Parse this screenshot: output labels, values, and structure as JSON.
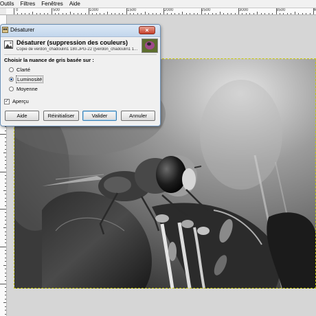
{
  "menu": {
    "items": [
      "Outils",
      "Filtres",
      "Fenêtres",
      "Aide"
    ]
  },
  "ruler": {
    "labels": [
      "0",
      "500",
      "1000",
      "1500",
      "2000",
      "2500",
      "3000",
      "3500",
      "4000"
    ]
  },
  "dialog": {
    "window_title": "Désaturer",
    "header_title": "Désaturer (suppression des couleurs)",
    "header_subtitle": "Copie de verdon_chadoulin1 180.JPG-22 ([verdon_chadoulin1 1...",
    "group_label": "Choisir la nuance de gris basée sur :",
    "options": [
      {
        "label": "Clarté",
        "selected": false
      },
      {
        "label": "Luminosité",
        "selected": true
      },
      {
        "label": "Moyenne",
        "selected": false
      }
    ],
    "preview_label": "Aperçu",
    "preview_checked": true,
    "buttons": {
      "help": "Aide",
      "reset": "Réinitialiser",
      "ok": "Valider",
      "cancel": "Annuler"
    }
  },
  "icons": {
    "dialog_icon": "gimp-icon",
    "close": "close-icon",
    "header": "desaturate-icon",
    "thumbnail": "image-thumbnail"
  }
}
